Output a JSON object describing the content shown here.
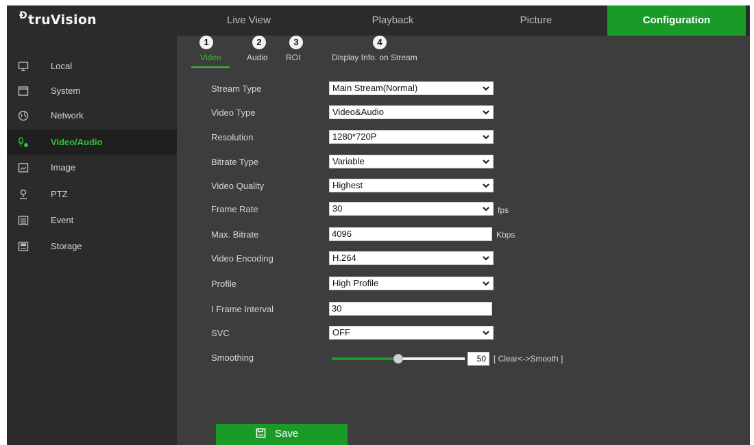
{
  "app": {
    "logo_mark": "Ð",
    "logo_text": "truVision"
  },
  "top_nav": [
    {
      "label": "Live View"
    },
    {
      "label": "Playback"
    },
    {
      "label": "Picture"
    },
    {
      "label": "Configuration",
      "active": true
    }
  ],
  "sidebar": {
    "items": [
      {
        "label": "Local",
        "icon": "monitor-icon"
      },
      {
        "label": "System",
        "icon": "system-window-icon"
      },
      {
        "label": "Network",
        "icon": "globe-icon"
      },
      {
        "label": "Video/Audio",
        "icon": "video-audio-icon",
        "active": true
      },
      {
        "label": "Image",
        "icon": "image-icon"
      },
      {
        "label": "PTZ",
        "icon": "ptz-icon"
      },
      {
        "label": "Event",
        "icon": "calendar-icon"
      },
      {
        "label": "Storage",
        "icon": "storage-icon"
      }
    ]
  },
  "sub_tabs": [
    {
      "label": "Video",
      "badge": "1",
      "active": true
    },
    {
      "label": "Audio",
      "badge": "2"
    },
    {
      "label": "ROI",
      "badge": "3"
    },
    {
      "label": "Display Info. on Stream",
      "badge": "4"
    }
  ],
  "form": {
    "stream_type": {
      "label": "Stream Type",
      "value": "Main Stream(Normal)"
    },
    "video_type": {
      "label": "Video Type",
      "value": "Video&Audio"
    },
    "resolution": {
      "label": "Resolution",
      "value": "1280*720P"
    },
    "bitrate_type": {
      "label": "Bitrate Type",
      "value": "Variable"
    },
    "video_quality": {
      "label": "Video Quality",
      "value": "Highest"
    },
    "frame_rate": {
      "label": "Frame Rate",
      "value": "30",
      "unit": "fps"
    },
    "max_bitrate": {
      "label": "Max. Bitrate",
      "value": "4096",
      "unit": "Kbps"
    },
    "video_encoding": {
      "label": "Video Encoding",
      "value": "H.264"
    },
    "profile": {
      "label": "Profile",
      "value": "High Profile"
    },
    "i_frame_interval": {
      "label": "I Frame Interval",
      "value": "30"
    },
    "svc": {
      "label": "SVC",
      "value": "OFF"
    },
    "smoothing": {
      "label": "Smoothing",
      "value": "50",
      "level_percent": 50,
      "hint": "[ Clear<->Smooth ]"
    }
  },
  "save": {
    "label": "Save"
  },
  "colors": {
    "accent": "#1a9a27",
    "accent_text": "#2fc33a",
    "panel": "#3d3d3d",
    "sidebar": "#2b2b2b"
  }
}
